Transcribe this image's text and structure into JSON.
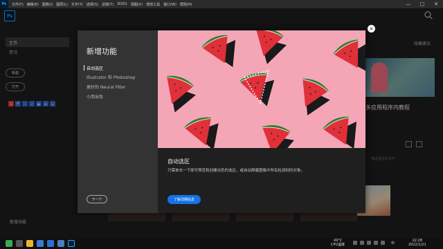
{
  "app": {
    "menu_logo": "Ps",
    "menu": [
      "文件(F)",
      "编辑(E)",
      "图像(I)",
      "图层(L)",
      "文字(Y)",
      "选择(S)",
      "滤镜(T)",
      "3D(D)",
      "视图(V)",
      "增效工具",
      "窗口(W)",
      "帮助(H)"
    ],
    "logo": "Ps",
    "window_controls": [
      "—",
      "□",
      "✕"
    ]
  },
  "left_nav": {
    "items": [
      "主页",
      "学习"
    ],
    "new_button": "新建",
    "open_button": "打开",
    "ext_icons": [
      "S",
      "中",
      "·",
      "♪",
      "▦",
      "❖",
      "⌂"
    ],
    "footer": "新增功能"
  },
  "background": {
    "suggestions_label": "隐藏建议",
    "tutorial_title": "多应用程序内教程",
    "search_hint": "筛选最近的文件"
  },
  "dialog": {
    "title": "新增功能",
    "features": [
      "自动选区",
      "Illustrator 和 Photoshop",
      "更好的 Neural Filter",
      "小而出色"
    ],
    "next_button": "下一个",
    "heading": "自动选区",
    "description": "只需单击一下即可预览和创建出色的选区，或自动屏蔽图像中所有检测到的对象。",
    "learn_more": "了解详细信息",
    "close": "×"
  },
  "taskbar": {
    "temp": "49°C",
    "temp_label": "CPU温度",
    "ime": "中",
    "time": "22:28",
    "date": "2022/1/21"
  },
  "colors": {
    "accent": "#1473e6",
    "ps_blue": "#31a8ff",
    "image_bg": "#f4a6b7",
    "melon_red": "#e0303a",
    "rind_green": "#2e7d3a"
  }
}
